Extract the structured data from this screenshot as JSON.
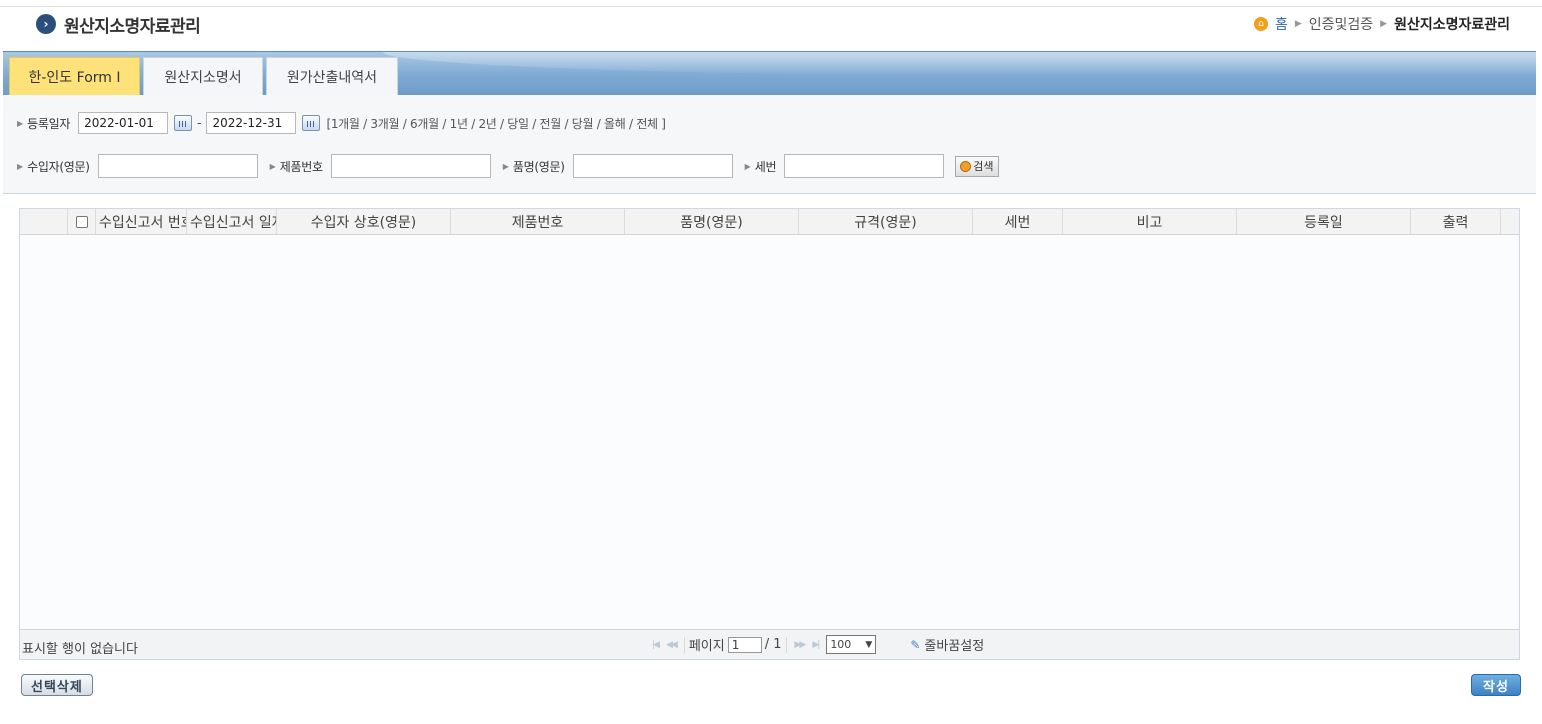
{
  "header": {
    "title": "원산지소명자료관리"
  },
  "breadcrumb": {
    "home": "홈",
    "level1": "인증및검증",
    "current": "원산지소명자료관리"
  },
  "tabs": [
    {
      "label": "한-인도 Form I",
      "active": true
    },
    {
      "label": "원산지소명서",
      "active": false
    },
    {
      "label": "원가산출내역서",
      "active": false
    }
  ],
  "search": {
    "reg_date_label": "등록일자",
    "date_from": "2022-01-01",
    "date_to": "2022-12-31",
    "date_dash": "-",
    "quick_ranges": "[1개월 / 3개월 / 6개월 / 1년 / 2년 / 당일 / 전월 / 당월 / 올해 / 전체 ]",
    "importer_label": "수입자(영문)",
    "product_no_label": "제품번호",
    "item_name_label": "품명(영문)",
    "hs_label": "세번",
    "search_button": "검색"
  },
  "grid": {
    "columns": [
      "수입신고서 번호",
      "수입신고서 일자",
      "수입자 상호(영문)",
      "제품번호",
      "품명(영문)",
      "규격(영문)",
      "세번",
      "비고",
      "등록일",
      "출력"
    ],
    "empty_message": "표시할 행이 없습니다",
    "pager": {
      "page_label": "페이지",
      "current_page": "1",
      "total_pages": "/ 1",
      "page_size": "100"
    },
    "wrap_setting": "줄바꿈설정"
  },
  "actions": {
    "delete_selected": "선택삭제",
    "write": "작성"
  },
  "colors": {
    "tab_active": "#fde27a",
    "tab_band": "#7ea9d2",
    "write_button": "#3d82c4",
    "title_icon": "#2b4f7d"
  }
}
